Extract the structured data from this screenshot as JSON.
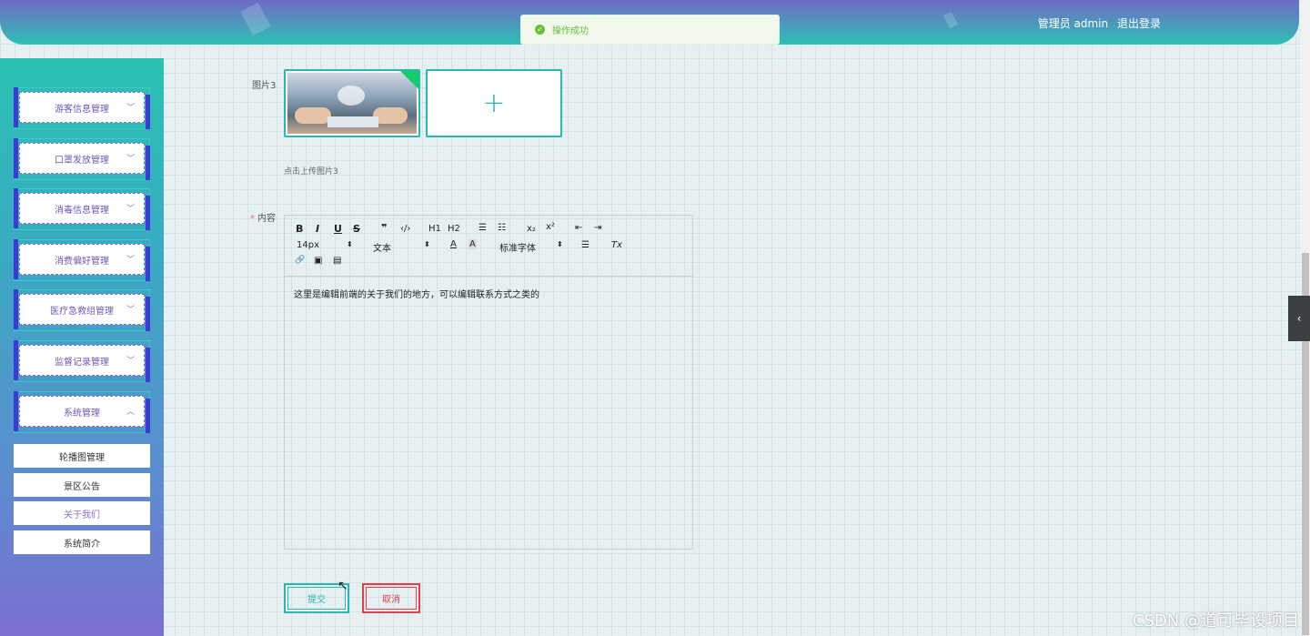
{
  "header": {
    "user_label": "管理员 admin",
    "logout_label": "退出登录"
  },
  "toast": {
    "message": "操作成功"
  },
  "sidebar": {
    "menus": [
      {
        "label": "游客信息管理",
        "expanded": false
      },
      {
        "label": "口罩发放管理",
        "expanded": false
      },
      {
        "label": "消毒信息管理",
        "expanded": false
      },
      {
        "label": "消费偏好管理",
        "expanded": false
      },
      {
        "label": "医疗急救组管理",
        "expanded": false
      },
      {
        "label": "监督记录管理",
        "expanded": false
      },
      {
        "label": "系统管理",
        "expanded": true
      }
    ],
    "submenus": [
      {
        "label": "轮播图管理"
      },
      {
        "label": "景区公告"
      },
      {
        "label": "关于我们",
        "active": true
      },
      {
        "label": "系统简介"
      }
    ]
  },
  "form": {
    "image3_label": "图片3",
    "image3_hint": "点击上传图片3",
    "content_label": "内容",
    "content_required_mark": "*",
    "content_text": "这里是编辑前端的关于我们的地方，可以编辑联系方式之类的"
  },
  "toolbar": {
    "bold": "B",
    "italic": "I",
    "underline": "U",
    "strike": "S",
    "blockquote": "❞",
    "code": "‹/›",
    "h1": "H1",
    "h2": "H2",
    "ordered_list": "☰",
    "bullet_list": "☷",
    "subscript": "x₂",
    "superscript": "x²",
    "outdent": "⇤",
    "indent": "⇥",
    "font_size": "14px",
    "header_select": "文本",
    "font_color": "A",
    "bg_color": "A",
    "font_family": "标准字体",
    "align": "☰",
    "clean": "Tx",
    "link": "🔗",
    "image": "▣",
    "video": "▤"
  },
  "buttons": {
    "submit": "提交",
    "cancel": "取消"
  },
  "watermark": "CSDN @道可毕设项目",
  "colors": {
    "accent": "#2ab7b0",
    "danger": "#d9434e",
    "menu_text": "#6e57b8"
  }
}
